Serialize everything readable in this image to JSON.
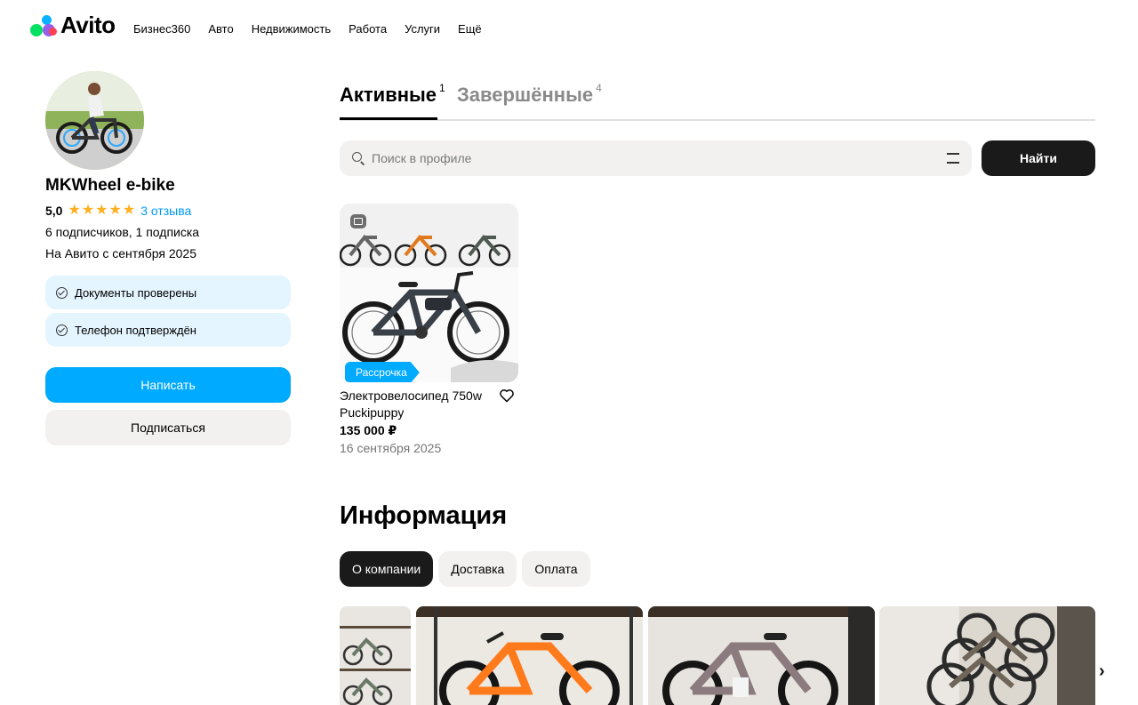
{
  "header": {
    "logo": "Avito",
    "nav": [
      "Бизнес360",
      "Авто",
      "Недвижимость",
      "Работа",
      "Услуги",
      "Ещё"
    ]
  },
  "seller": {
    "name": "MKWheel e-bike",
    "rating": "5,0",
    "stars": 5,
    "reviews": "3 отзыва",
    "followers": "6 подписчиков, 1 подписка",
    "since": "На Авито с сентября 2025",
    "verifications": [
      "Документы проверены",
      "Телефон подтверждён"
    ],
    "write_button": "Написать",
    "subscribe_button": "Подписаться"
  },
  "tabs": [
    {
      "label": "Активные",
      "count": "1"
    },
    {
      "label": "Завершённые",
      "count": "4"
    }
  ],
  "search": {
    "placeholder": "Поиск в профиле",
    "button": "Найти"
  },
  "listing": {
    "badge": "Рассрочка",
    "title": "Электровелосипед 750w Puckipuppy",
    "price": "135 000 ₽",
    "date": "16 сентября 2025"
  },
  "info": {
    "title": "Информация",
    "chips": [
      "О компании",
      "Доставка",
      "Оплата"
    ]
  },
  "colors": {
    "accent_blue": "#00aaff",
    "star": "#ffb021",
    "verify_bg": "#e5f5ff"
  }
}
